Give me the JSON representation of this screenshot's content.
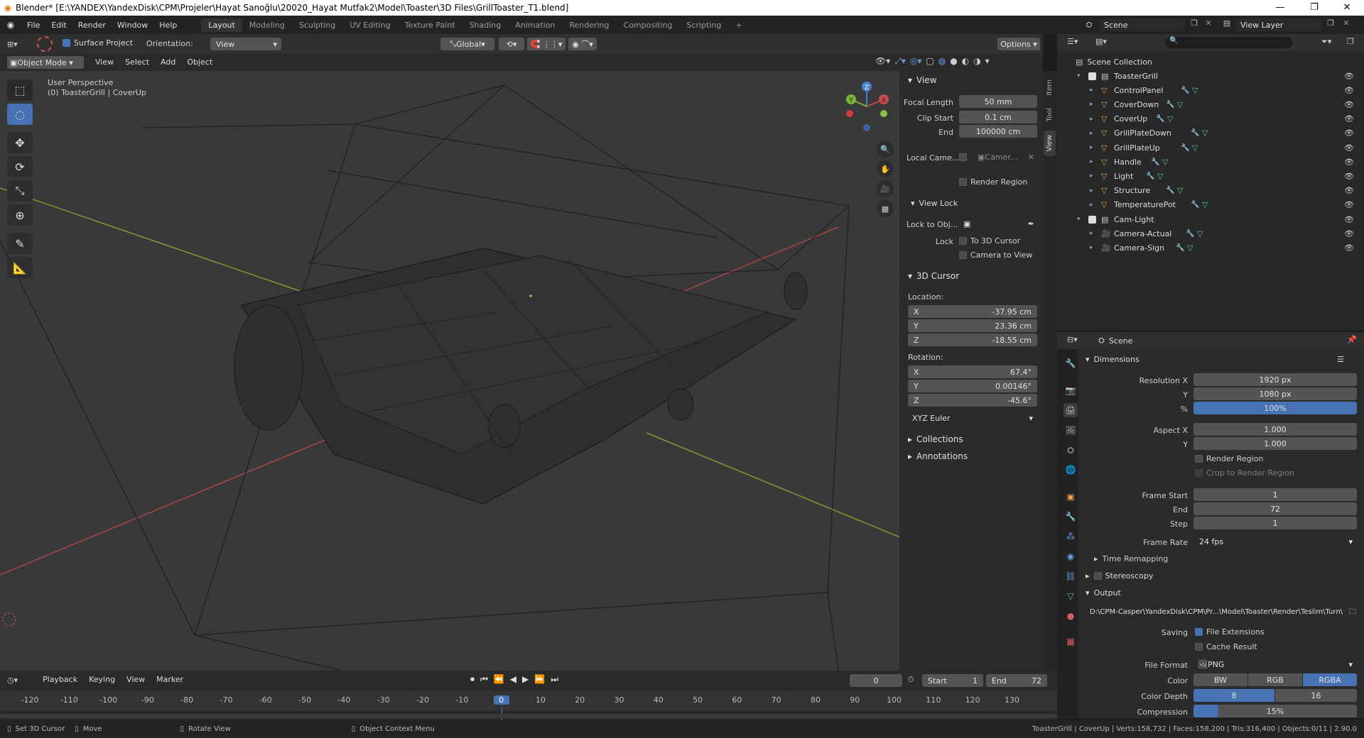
{
  "window": {
    "title": "Blender* [E:\\YANDEX\\YandexDisk\\CPM\\Projeler\\Hayat Sanoğlu\\20020_Hayat Mutfak2\\Model\\Toaster\\3D Files\\GrillToaster_T1.blend]"
  },
  "menubar": {
    "menus": [
      "File",
      "Edit",
      "Render",
      "Window",
      "Help"
    ],
    "workspaces": [
      "Layout",
      "Modeling",
      "Sculpting",
      "UV Editing",
      "Texture Paint",
      "Shading",
      "Animation",
      "Rendering",
      "Compositing",
      "Scripting"
    ],
    "add_tab": "+",
    "scene": "Scene",
    "view_layer": "View Layer"
  },
  "tool_header": {
    "surface_project": "Surface Project",
    "orientation_label": "Orientation:",
    "orientation_value": "View",
    "transform": "Global",
    "options": "Options"
  },
  "viewport_header": {
    "mode": "Object Mode",
    "menus": [
      "View",
      "Select",
      "Add",
      "Object"
    ]
  },
  "viewport": {
    "perspective": "User Perspective",
    "object_info": "(0) ToasterGrill | CoverUp",
    "gizmo": {
      "z": "Z",
      "y": "Y",
      "x": "X"
    }
  },
  "npanel": {
    "tabs": [
      "Item",
      "Tool",
      "View"
    ],
    "view": {
      "title": "View",
      "focal_length_label": "Focal Length",
      "focal_length": "50 mm",
      "clip_start_label": "Clip Start",
      "clip_start": "0.1 cm",
      "clip_end_label": "End",
      "clip_end": "100000 cm",
      "local_camera_label": "Local Came...",
      "local_camera_value": "Camer...",
      "render_region": "Render Region"
    },
    "view_lock": {
      "title": "View Lock",
      "lock_to_obj_label": "Lock to Obj...",
      "lock_label": "Lock",
      "to_3d_cursor": "To 3D Cursor",
      "camera_to_view": "Camera to View"
    },
    "cursor": {
      "title": "3D Cursor",
      "location_label": "Location:",
      "x_label": "X",
      "x": "-37.95 cm",
      "y_label": "Y",
      "y": "23.36 cm",
      "z_label": "Z",
      "z": "-18.55 cm",
      "rotation_label": "Rotation:",
      "rx_label": "X",
      "rx": "67.4°",
      "ry_label": "Y",
      "ry": "0.00146°",
      "rz_label": "Z",
      "rz": "-45.6°",
      "rotation_mode": "XYZ Euler"
    },
    "collections": "Collections",
    "annotations": "Annotations"
  },
  "outliner": {
    "root": "Scene Collection",
    "items": [
      {
        "name": "ToasterGrill",
        "level": 0
      },
      {
        "name": "ControlPanel",
        "level": 1
      },
      {
        "name": "CoverDown",
        "level": 1
      },
      {
        "name": "CoverUp",
        "level": 1
      },
      {
        "name": "GrillPlateDown",
        "level": 1
      },
      {
        "name": "GrillPlateUp",
        "level": 1
      },
      {
        "name": "Handle",
        "level": 1
      },
      {
        "name": "Light",
        "level": 1
      },
      {
        "name": "Structure",
        "level": 1
      },
      {
        "name": "TemperaturePot",
        "level": 1
      },
      {
        "name": "Cam-Light",
        "level": 0
      },
      {
        "name": "Camera-Actual",
        "level": 1
      },
      {
        "name": "Camera-Sign",
        "level": 1
      }
    ]
  },
  "properties": {
    "context": "Scene",
    "dimensions": {
      "title": "Dimensions",
      "res_x_label": "Resolution X",
      "res_x": "1920 px",
      "res_y_label": "Y",
      "res_y": "1080 px",
      "pct_label": "%",
      "pct": "100%",
      "aspect_x_label": "Aspect X",
      "aspect_x": "1.000",
      "aspect_y_label": "Y",
      "aspect_y": "1.000",
      "render_region": "Render Region",
      "crop": "Crop to Render Region",
      "frame_start_label": "Frame Start",
      "frame_start": "1",
      "frame_end_label": "End",
      "frame_end": "72",
      "step_label": "Step",
      "step": "1",
      "frame_rate_label": "Frame Rate",
      "frame_rate": "24 fps",
      "time_remapping": "Time Remapping"
    },
    "stereoscopy": "Stereoscopy",
    "output": {
      "title": "Output",
      "path": "D:\\CPM-Casper\\YandexDisk\\CPM\\Pr...\\Model\\Toaster\\Render\\Teslim\\Turn\\",
      "saving_label": "Saving",
      "file_extensions": "File Extensions",
      "cache_result": "Cache Result",
      "file_format_label": "File Format",
      "file_format": "PNG",
      "color_label": "Color",
      "color_bw": "BW",
      "color_rgb": "RGB",
      "color_rgba": "RGBA",
      "depth_label": "Color Depth",
      "depth_8": "8",
      "depth_16": "16",
      "compression_label": "Compression",
      "compression": "15%"
    }
  },
  "timeline": {
    "menus": [
      "Playback",
      "Keying",
      "View",
      "Marker"
    ],
    "current_frame": "0",
    "start_label": "Start",
    "start": "1",
    "end_label": "End",
    "end": "72",
    "ticks": [
      "-120",
      "-110",
      "-100",
      "-90",
      "-80",
      "-70",
      "-60",
      "-50",
      "-40",
      "-30",
      "-20",
      "-10",
      "0",
      "10",
      "20",
      "30",
      "40",
      "50",
      "60",
      "70",
      "80",
      "90",
      "100",
      "110",
      "120",
      "130"
    ]
  },
  "statusbar": {
    "set_cursor": "Set 3D Cursor",
    "move": "Move",
    "rotate": "Rotate View",
    "context_menu": "Object Context Menu",
    "stats": "ToasterGrill | CoverUp | Verts:158,732 | Faces:158,200 | Tris:316,400 | Objects:0/11 | 2.90.0"
  },
  "colors": {
    "accent": "#4772b3",
    "grid_x": "#a84646",
    "grid_y": "#7d9a33",
    "icon_orange": "#e9a14a",
    "icon_green": "#57c59a"
  }
}
